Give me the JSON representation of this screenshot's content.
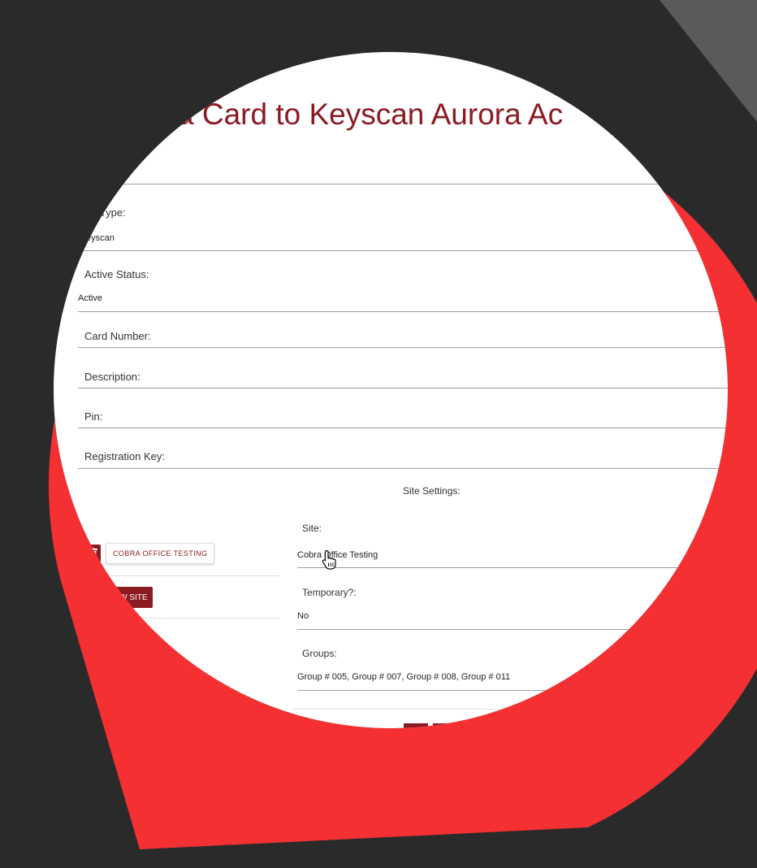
{
  "title": "a Card to Keyscan Aurora Ac",
  "card_type": {
    "label": "rd Type:",
    "value": "eyscan"
  },
  "active_status": {
    "label": "Active Status:",
    "value": "Active"
  },
  "card_number": {
    "label": "Card Number:"
  },
  "description": {
    "label": "Description:"
  },
  "pin": {
    "label": "Pin:"
  },
  "registration_key": {
    "label": "Registration Key:"
  },
  "site_settings": {
    "heading": "Site Settings:",
    "site_chip": "COBRA OFFICE TESTING",
    "new_site_button": "EW SITE",
    "site": {
      "label": "Site:",
      "value": "Cobra Office Testing"
    },
    "temporary": {
      "label": "Temporary?:",
      "value": "No"
    },
    "groups": {
      "label": "Groups:",
      "value": "Group # 005, Group # 007, Group # 008, Group # 011"
    }
  },
  "colors": {
    "accent": "#8b1a22",
    "pin": "#f53032",
    "background": "#2a2a2a"
  },
  "icons": [
    "trash-icon",
    "hand-cursor-icon",
    "map-pin-icon"
  ]
}
